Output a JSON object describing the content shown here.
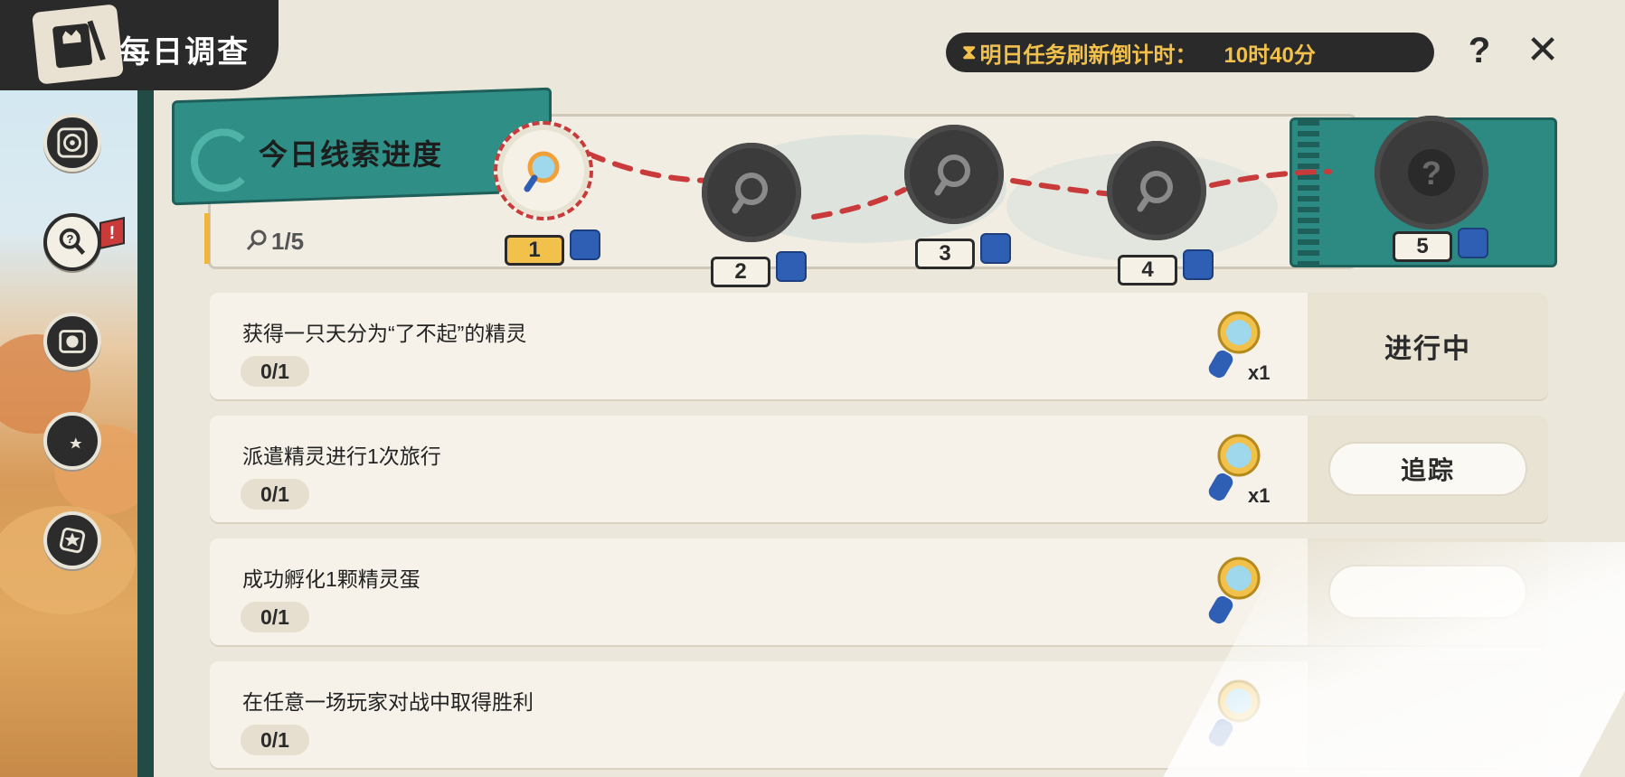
{
  "header": {
    "title": "每日调查",
    "timer_label": "明日任务刷新倒计时：",
    "timer_value": "10时40分",
    "help_label": "?",
    "close_label": "✕"
  },
  "sidebar": {
    "items": [
      {
        "name": "compass-icon"
      },
      {
        "name": "clue-icon",
        "active": true,
        "flag": "!"
      },
      {
        "name": "fist-icon"
      },
      {
        "name": "star-moon-icon"
      },
      {
        "name": "star-badge-icon"
      }
    ]
  },
  "progress": {
    "title": "今日线索进度",
    "count": "1/5",
    "nodes": [
      "1",
      "2",
      "3",
      "4",
      "5"
    ],
    "completed": 1
  },
  "tasks": [
    {
      "title": "获得一只天分为“了不起”的精灵",
      "progress": "0/1",
      "reward_count": "x1",
      "status": "进行中",
      "status_type": "in-progress"
    },
    {
      "title": "派遣精灵进行1次旅行",
      "progress": "0/1",
      "reward_count": "x1",
      "status": "追踪",
      "status_type": "track"
    },
    {
      "title": "成功孵化1颗精灵蛋",
      "progress": "0/1",
      "reward_count": "",
      "status": "",
      "status_type": "track"
    },
    {
      "title": "在任意一场玩家对战中取得胜利",
      "progress": "0/1",
      "reward_count": "",
      "status": "",
      "status_type": "none"
    }
  ],
  "colors": {
    "accent_teal": "#2f8f86",
    "dark": "#2a2a2a",
    "gold": "#f2c14b",
    "red": "#c93a3a"
  }
}
